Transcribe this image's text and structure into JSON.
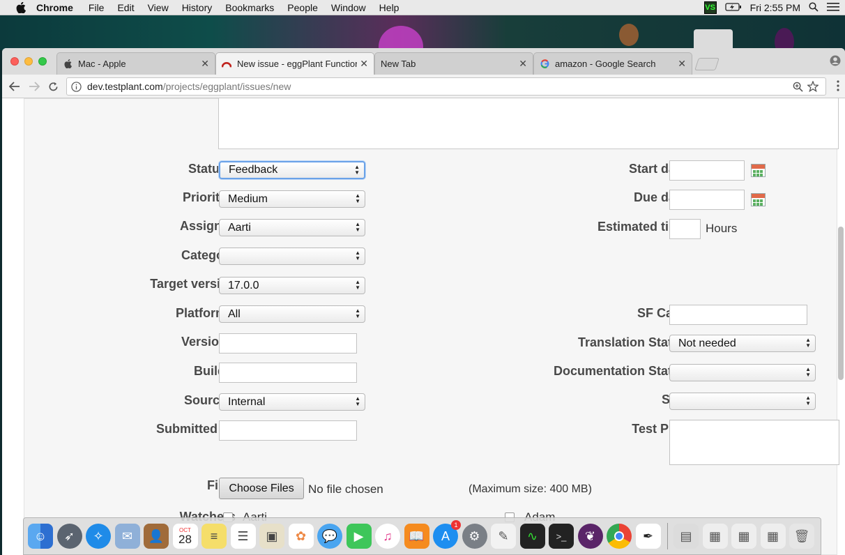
{
  "menubar": {
    "app": "Chrome",
    "items": [
      "File",
      "Edit",
      "View",
      "History",
      "Bookmarks",
      "People",
      "Window",
      "Help"
    ],
    "clock": "Fri 2:55 PM",
    "vs_icon": "VS"
  },
  "tabs": [
    {
      "title": "Mac - Apple",
      "icon": "apple-icon"
    },
    {
      "title": "New issue - eggPlant Functional",
      "icon": "redmine-icon",
      "active": true
    },
    {
      "title": "New Tab",
      "icon": ""
    },
    {
      "title": "amazon - Google Search",
      "icon": "google-icon"
    }
  ],
  "url": {
    "host": "dev.testplant.com",
    "path": "/projects/eggplant/issues/new"
  },
  "form": {
    "status": {
      "label": "Status",
      "value": "Feedback"
    },
    "priority": {
      "label": "Priority",
      "value": "Medium"
    },
    "assignee": {
      "label": "Assignee",
      "value": "Aarti"
    },
    "category": {
      "label": "Category",
      "value": ""
    },
    "target_version": {
      "label": "Target version",
      "value": "17.0.0"
    },
    "platform": {
      "label": "Platform",
      "value": "All"
    },
    "version": {
      "label": "Version",
      "value": ""
    },
    "build": {
      "label": "Build #",
      "value": ""
    },
    "source": {
      "label": "Source",
      "value": "Internal"
    },
    "submitted_by": {
      "label": "Submitted by",
      "value": ""
    },
    "start_date": {
      "label": "Start date",
      "value": ""
    },
    "due_date": {
      "label": "Due date",
      "value": ""
    },
    "estimated_time": {
      "label": "Estimated time",
      "value": "",
      "unit": "Hours"
    },
    "sf_case": {
      "label": "SF Case",
      "value": ""
    },
    "translation_status": {
      "label": "Translation Status",
      "value": "Not needed"
    },
    "documentation_status": {
      "label": "Documentation Status",
      "value": ""
    },
    "size": {
      "label": "Size",
      "value": ""
    },
    "test_plan": {
      "label": "Test Plan",
      "value": ""
    },
    "files": {
      "label": "Files",
      "button": "Choose Files",
      "status": "No file chosen",
      "max": "(Maximum size: 400 MB)"
    },
    "watchers": {
      "label": "Watchers",
      "left": "Aarti",
      "right": "Adam"
    }
  },
  "dock": {
    "calendar_month": "OCT",
    "calendar_day": "28",
    "appstore_badge": "1"
  },
  "colors": {
    "required": "#bb0000",
    "focus": "#6aa2e8",
    "label": "#484848"
  }
}
